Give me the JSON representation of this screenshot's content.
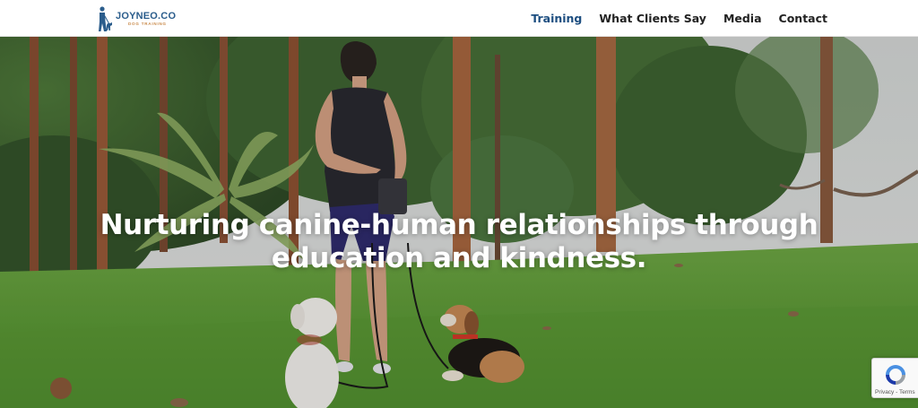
{
  "header": {
    "logo": {
      "name": "JOYNEO.CO",
      "sub": "DOG TRAINING"
    },
    "nav": [
      {
        "label": "Training",
        "active": true
      },
      {
        "label": "What Clients Say",
        "active": false
      },
      {
        "label": "Media",
        "active": false
      },
      {
        "label": "Contact",
        "active": false
      }
    ]
  },
  "hero": {
    "headline_line1": "Nurturing canine-human relationships through",
    "headline_line2": "education and kindness."
  },
  "recaptcha": {
    "privacy": "Privacy",
    "separator": " - ",
    "terms": "Terms"
  },
  "colors": {
    "nav_active": "#1d4e80",
    "nav_text": "#222222",
    "logo_blue": "#2b5d8c",
    "logo_orange": "#c98a4a"
  }
}
